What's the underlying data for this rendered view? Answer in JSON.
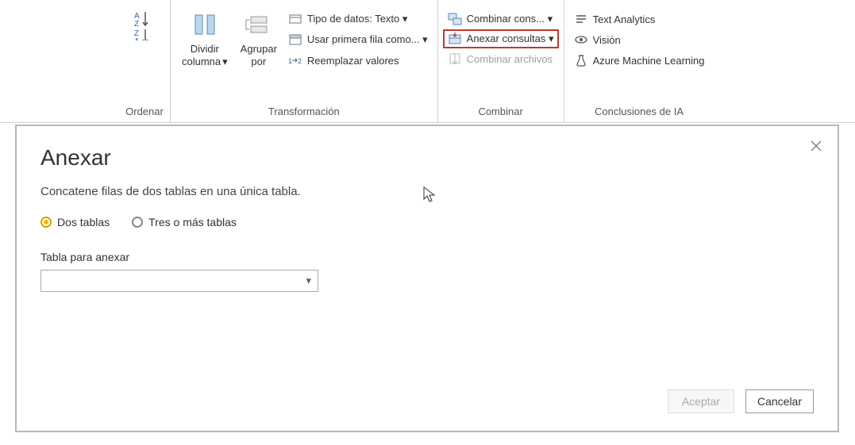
{
  "ribbon": {
    "groups": {
      "sort": {
        "label": "Ordenar"
      },
      "transform": {
        "label": "Transformación",
        "split": "Dividir\ncolumna",
        "group": "Agrupar\npor",
        "datatype": "Tipo de datos: Texto",
        "firstrow": "Usar primera fila como...",
        "replace": "Reemplazar valores"
      },
      "combine": {
        "label": "Combinar",
        "merge": "Combinar cons...",
        "append": "Anexar consultas",
        "files": "Combinar archivos"
      },
      "ai": {
        "label": "Conclusiones de IA",
        "text": "Text Analytics",
        "vision": "Visión",
        "azure": "Azure Machine Learning"
      }
    }
  },
  "dialog": {
    "title": "Anexar",
    "subtitle": "Concatene filas de dos tablas en una única tabla.",
    "radio": {
      "two": "Dos tablas",
      "three": "Tres o más tablas"
    },
    "field_label": "Tabla para anexar",
    "accept": "Aceptar",
    "cancel": "Cancelar"
  }
}
